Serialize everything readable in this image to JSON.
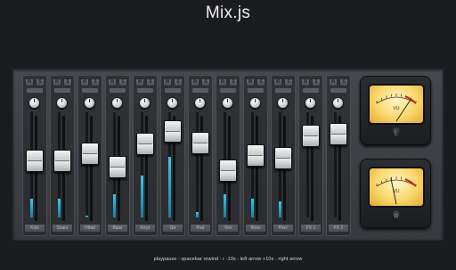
{
  "app": {
    "title": "Mix.js"
  },
  "strips": [
    {
      "name": "Kick",
      "fader": 0.55,
      "level": 0.18,
      "mute_label": "M",
      "solo_label": "S"
    },
    {
      "name": "Snare",
      "fader": 0.55,
      "level": 0.18,
      "mute_label": "M",
      "solo_label": "S"
    },
    {
      "name": "Hihat",
      "fader": 0.62,
      "level": 0.02,
      "mute_label": "M",
      "solo_label": "S"
    },
    {
      "name": "Bass",
      "fader": 0.48,
      "level": 0.22,
      "mute_label": "M",
      "solo_label": "S"
    },
    {
      "name": "Keys",
      "fader": 0.72,
      "level": 0.4,
      "mute_label": "M",
      "solo_label": "S"
    },
    {
      "name": "Gtr",
      "fader": 0.85,
      "level": 0.58,
      "mute_label": "M",
      "solo_label": "S"
    },
    {
      "name": "Pad",
      "fader": 0.73,
      "level": 0.05,
      "mute_label": "M",
      "solo_label": "S"
    },
    {
      "name": "Vox",
      "fader": 0.45,
      "level": 0.22,
      "mute_label": "M",
      "solo_label": "S"
    },
    {
      "name": "Bvox",
      "fader": 0.6,
      "level": 0.18,
      "mute_label": "M",
      "solo_label": "S"
    },
    {
      "name": "Perc",
      "fader": 0.57,
      "level": 0.15,
      "mute_label": "M",
      "solo_label": "S"
    },
    {
      "name": "FX 1",
      "fader": 0.8,
      "level": 0.0,
      "mute_label": "M",
      "solo_label": "S"
    },
    {
      "name": "FX 2",
      "fader": 0.82,
      "level": 0.0,
      "mute_label": "M",
      "solo_label": "S"
    }
  ],
  "vu_meters": [
    {
      "channel": "L",
      "unit": "VU",
      "needle": 0.78
    },
    {
      "channel": "R",
      "unit": "VU",
      "needle": 0.4
    }
  ],
  "shortcuts": "playpause : spacebar    rewind : r    -10s : left arrow    +10s : right arrow"
}
